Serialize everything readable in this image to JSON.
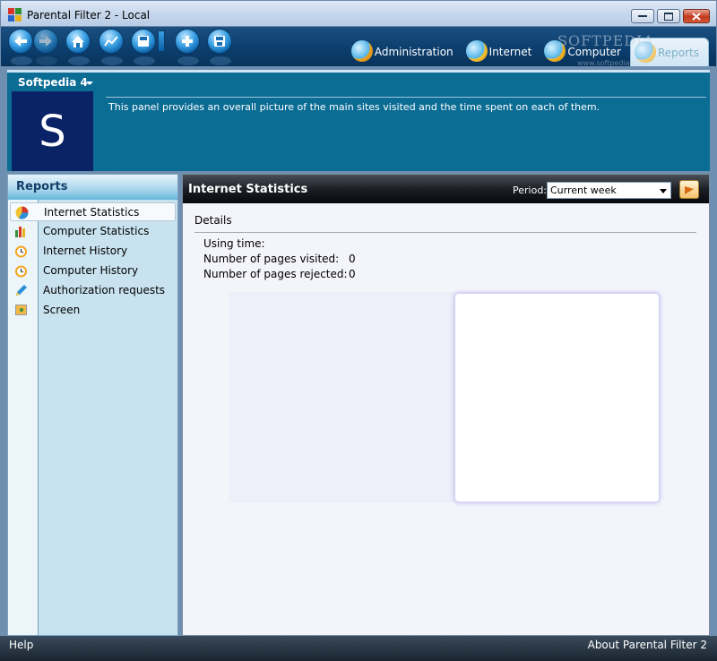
{
  "window": {
    "title": "Parental Filter 2 - Local"
  },
  "toolbar": {
    "buttons": [
      "back-icon",
      "forward-icon",
      "home-icon",
      "chart-icon",
      "save-dropdown-icon",
      "add-icon",
      "disk-icon"
    ]
  },
  "tabs": [
    {
      "label": "Administration",
      "icon": "administration-gear-icon"
    },
    {
      "label": "Internet",
      "icon": "internet-icon"
    },
    {
      "label": "Computer",
      "icon": "computer-icon"
    },
    {
      "label": "Reports",
      "icon": "reports-icon",
      "active": true
    }
  ],
  "watermark": {
    "text": "SOFTPEDIA",
    "sub": "www.softpedia.com"
  },
  "profile": {
    "name": "Softpedia 4",
    "avatar_letter": "S",
    "description": "This panel provides an overall picture of the main sites visited and the time spent on each of them."
  },
  "sidebar": {
    "title": "Reports",
    "items": [
      {
        "label": "Internet Statistics",
        "selected": true,
        "icon": "pie-chart-icon"
      },
      {
        "label": "Computer Statistics",
        "icon": "bar-chart-icon"
      },
      {
        "label": "Internet History",
        "icon": "clock-icon"
      },
      {
        "label": "Computer History",
        "icon": "clock-icon"
      },
      {
        "label": "Authorization requests",
        "icon": "pencil-icon"
      },
      {
        "label": "Screen",
        "icon": "screen-icon"
      }
    ]
  },
  "content": {
    "title": "Internet Statistics",
    "period_label": "Period:",
    "period_value": "Current week",
    "details_title": "Details",
    "stats": [
      {
        "label": "Using time:",
        "value": ""
      },
      {
        "label": "Number of pages visited:",
        "value": "0"
      },
      {
        "label": "Number of pages rejected:",
        "value": "0"
      }
    ]
  },
  "statusbar": {
    "help": "Help",
    "about": "About Parental Filter 2"
  },
  "colors": {
    "toolbar": "#0c3d6c",
    "header": "#0b6c94",
    "avatar": "#0a2366",
    "sidebar": "#c8e2ef",
    "content_bg": "#f4f4fb"
  }
}
